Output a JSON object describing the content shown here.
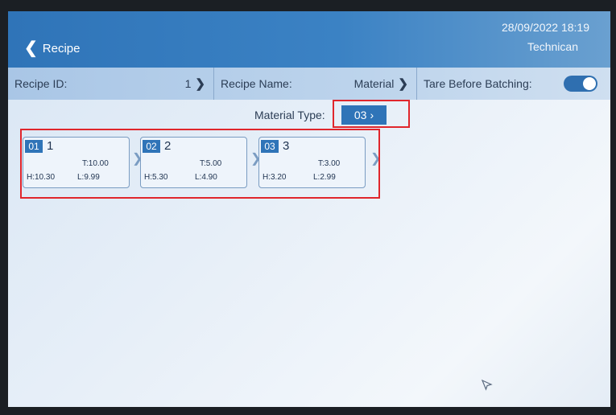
{
  "header": {
    "back_label": "Recipe",
    "datetime": "28/09/2022 18:19",
    "user_role": "Technican"
  },
  "info_row": {
    "recipe_id_label": "Recipe ID:",
    "recipe_id_value": "1",
    "recipe_name_label": "Recipe Name:",
    "recipe_name_value": "Material",
    "tare_label": "Tare Before Batching:",
    "tare_enabled": true
  },
  "material_type": {
    "label": "Material Type:",
    "value": "03"
  },
  "materials": [
    {
      "num": "01",
      "name": "1",
      "target": "T:10.00",
      "high": "H:10.30",
      "low": "L:9.99"
    },
    {
      "num": "02",
      "name": "2",
      "target": "T:5.00",
      "high": "H:5.30",
      "low": "L:4.90"
    },
    {
      "num": "03",
      "name": "3",
      "target": "T:3.00",
      "high": "H:3.20",
      "low": "L:2.99"
    }
  ],
  "colors": {
    "header_blue": "#3b82c4",
    "accent_blue": "#2f74b8",
    "highlight_red": "#e0262c"
  },
  "icons": {
    "back": "chevron-left-icon",
    "forward": "chevron-right-icon",
    "cursor": "mouse-pointer-icon"
  }
}
